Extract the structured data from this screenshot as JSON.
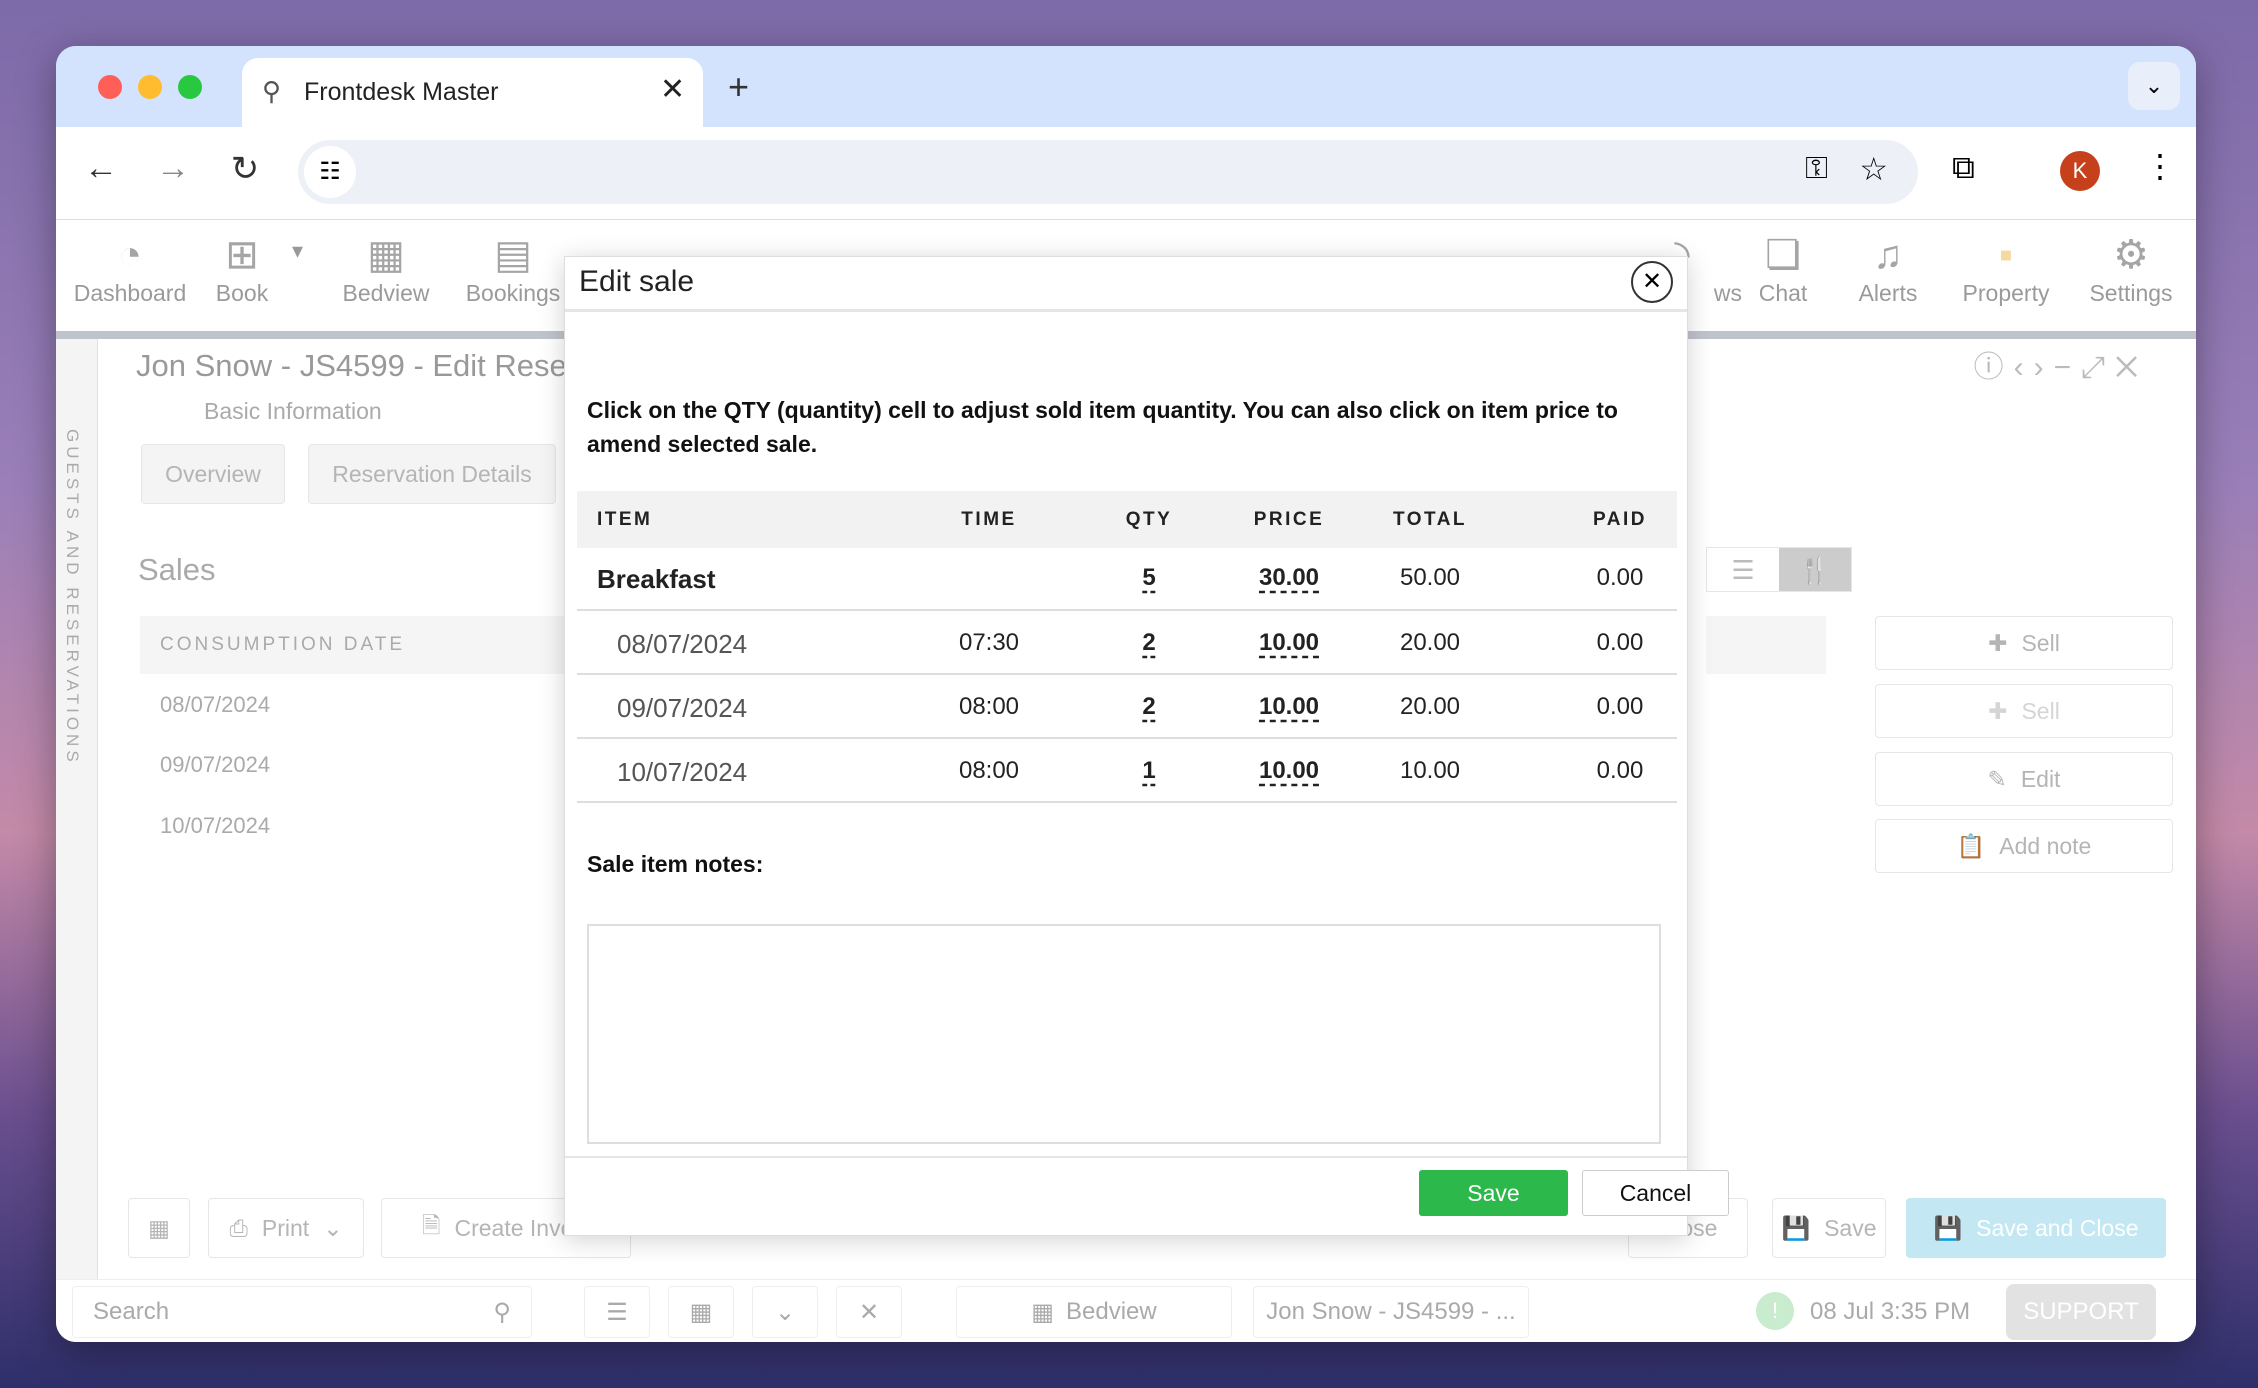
{
  "browser": {
    "tab_title": "Frontdesk Master",
    "profile_initial": "K",
    "colors": {
      "close": "#ff5f57",
      "minimize": "#febc2e",
      "maximize": "#28c840",
      "profile": "#c5401b"
    }
  },
  "toolbar": {
    "items": [
      {
        "label": "Dashboard",
        "icon": "gauge-icon"
      },
      {
        "label": "Book",
        "icon": "plus-square-icon"
      },
      {
        "label": "Bedview",
        "icon": "grid-icon"
      },
      {
        "label": "Bookings",
        "icon": "book-icon"
      },
      {
        "label": "ws",
        "icon": "rss-icon"
      },
      {
        "label": "Chat",
        "icon": "chat-icon"
      },
      {
        "label": "Alerts",
        "icon": "bell-icon"
      },
      {
        "label": "Property",
        "icon": "property-icon"
      },
      {
        "label": "Settings",
        "icon": "gear-icon"
      }
    ]
  },
  "sidebar": {
    "label": "GUESTS AND RESERVATIONS"
  },
  "page": {
    "title": "Jon Snow - JS4599 - Edit Rese",
    "section": "Basic Information",
    "tabs": [
      "Overview",
      "Reservation Details"
    ],
    "sales_heading": "Sales",
    "table_header": "CONSUMPTION DATE",
    "dates": [
      "08/07/2024",
      "09/07/2024",
      "10/07/2024"
    ],
    "actions": [
      "Sell",
      "Sell",
      "Edit",
      "Add note"
    ]
  },
  "action_bar": {
    "print": "Print",
    "create_invoice": "Create Invoic",
    "close": "Close",
    "save": "Save",
    "save_close": "Save and Close"
  },
  "bottom_bar": {
    "search_placeholder": "Search",
    "bedview": "Bedview",
    "reservation": "Jon Snow - JS4599 - ...",
    "datetime": "08 Jul 3:35 PM",
    "support": "SUPPORT"
  },
  "modal": {
    "title": "Edit sale",
    "instructions": "Click on the QTY (quantity) cell to adjust sold item quantity. You can also click on item price to amend selected sale.",
    "columns": [
      "ITEM",
      "TIME",
      "QTY",
      "PRICE",
      "TOTAL",
      "PAID"
    ],
    "group": {
      "item": "Breakfast",
      "time": "",
      "qty": "5",
      "price": "30.00",
      "total": "50.00",
      "paid": "0.00"
    },
    "rows": [
      {
        "item": "08/07/2024",
        "time": "07:30",
        "qty": "2",
        "price": "10.00",
        "total": "20.00",
        "paid": "0.00"
      },
      {
        "item": "09/07/2024",
        "time": "08:00",
        "qty": "2",
        "price": "10.00",
        "total": "20.00",
        "paid": "0.00"
      },
      {
        "item": "10/07/2024",
        "time": "08:00",
        "qty": "1",
        "price": "10.00",
        "total": "10.00",
        "paid": "0.00"
      }
    ],
    "notes_label": "Sale item notes:",
    "notes_value": "",
    "save": "Save",
    "cancel": "Cancel",
    "save_color": "#2db84b"
  }
}
